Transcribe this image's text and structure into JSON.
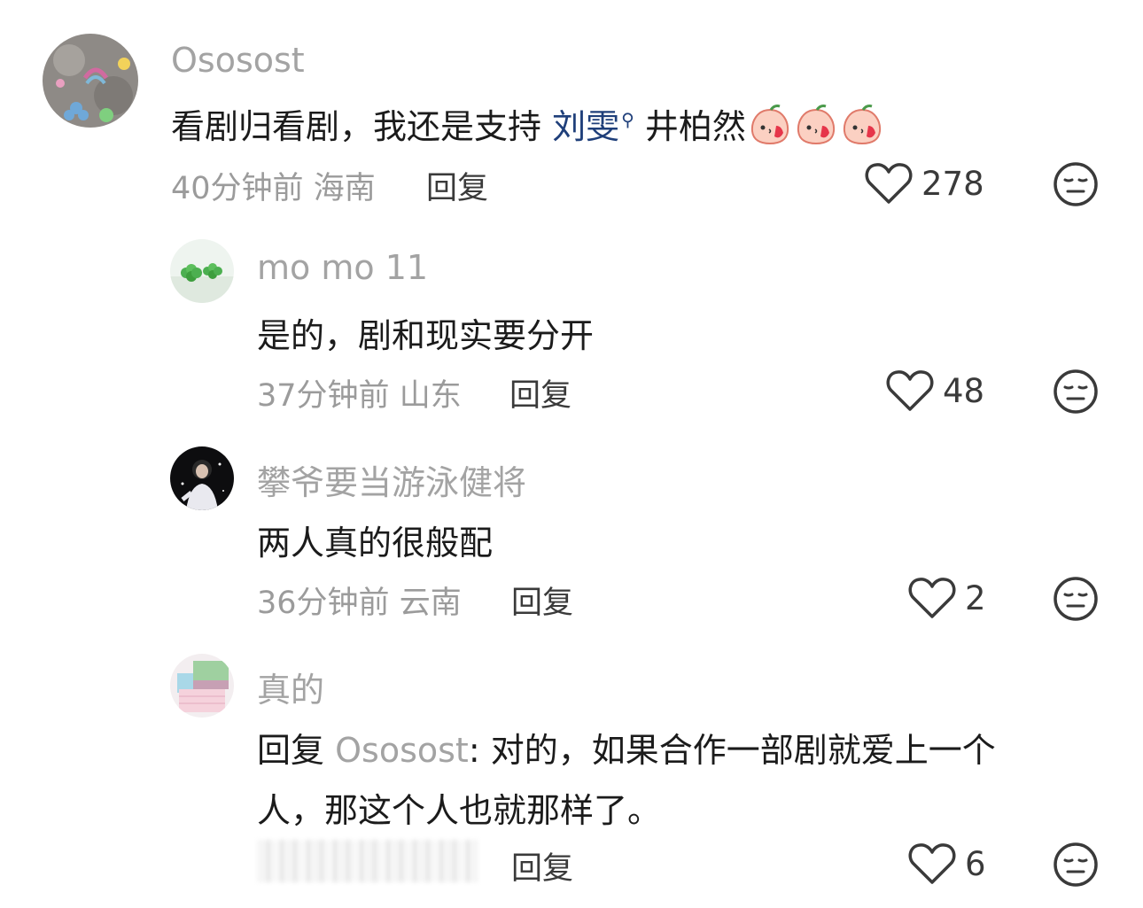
{
  "comments": [
    {
      "username": "Ososost",
      "text_before": "看剧归看剧，我还是支持",
      "mention": "刘雯",
      "text_after": "井柏然",
      "emoji_icon": "kiss-face-emoji",
      "time": "40分钟前",
      "location": "海南",
      "reply_label": "回复",
      "likes": "278"
    },
    {
      "username": "mo mo 11",
      "text": "是的，剧和现实要分开",
      "time": "37分钟前",
      "location": "山东",
      "reply_label": "回复",
      "likes": "48"
    },
    {
      "username": "攀爷要当游泳健将",
      "text": "两人真的很般配",
      "time": "36分钟前",
      "location": "云南",
      "reply_label": "回复",
      "likes": "2"
    },
    {
      "username": "真的",
      "reply_prefix": "回复",
      "reply_to": "Ososost",
      "text_line1": ": 对的，如果合作一部剧就爱上一个",
      "text_line2": "人，那这个人也就那样了。",
      "reply_label": "回复",
      "likes": "6"
    }
  ],
  "icons": {
    "like": "heart-outline-icon",
    "dislike": "meh-face-icon",
    "mention_search": "search-icon"
  }
}
